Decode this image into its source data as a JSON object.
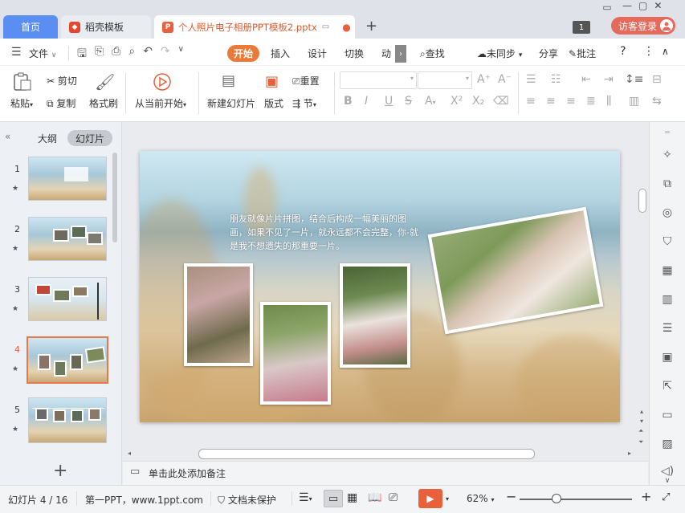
{
  "titlebar": {
    "tabs": [
      {
        "label": "首页"
      },
      {
        "label": "稻壳模板"
      },
      {
        "label": "个人照片电子相册PPT模板2.pptx"
      }
    ],
    "notification_count": "1",
    "login_label": "访客登录"
  },
  "menu": {
    "file": "文件",
    "items": [
      "开始",
      "插入",
      "设计",
      "切换",
      "动"
    ],
    "search": "查找",
    "sync": "未同步",
    "share": "分享",
    "annotate": "批注"
  },
  "ribbon": {
    "paste": "粘贴",
    "cut": "剪切",
    "copy": "复制",
    "format_painter": "格式刷",
    "from_current": "从当前开始",
    "new_slide": "新建幻灯片",
    "layout": "版式",
    "reset": "重置",
    "section": "节"
  },
  "left_panel": {
    "tab_outline": "大纲",
    "tab_slides": "幻灯片",
    "slides": [
      {
        "num": "1"
      },
      {
        "num": "2"
      },
      {
        "num": "3"
      },
      {
        "num": "4"
      },
      {
        "num": "5"
      }
    ],
    "selected_index": 4
  },
  "slide": {
    "text": "朋友就像片片拼图，结合后构成一幅美丽的图画，如果不见了一片，就永远都不会完整，你-就是我不想遗失的那重要一片。"
  },
  "notes": {
    "placeholder": "单击此处添加备注"
  },
  "status": {
    "slide_counter": "幻灯片 4 / 16",
    "author": "第一PPT，www.1ppt.com",
    "protect": "文档未保护",
    "zoom": "62%",
    "zoom_fraction": 0.33
  },
  "colors": {
    "accent": "#e97a3a",
    "home_tab": "#5b8ef1",
    "login": "#e66a5c",
    "play": "#e8603c"
  }
}
